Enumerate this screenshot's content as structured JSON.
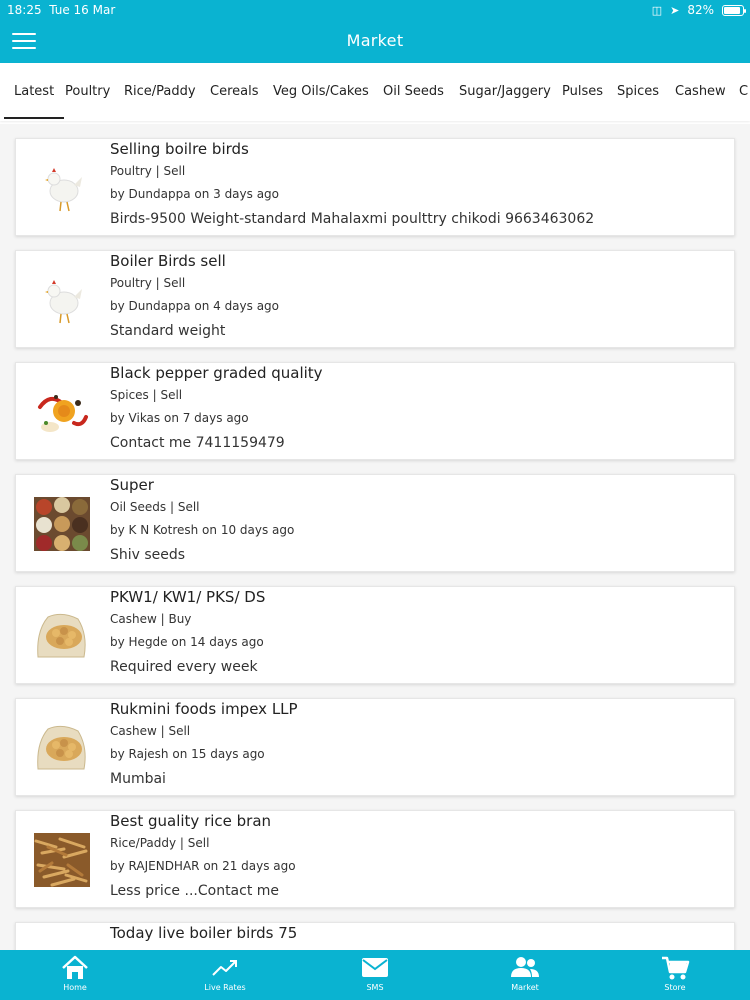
{
  "status_bar": {
    "time": "18:25",
    "date": "Tue 16 Mar",
    "battery": "82%"
  },
  "nav": {
    "title": "Market"
  },
  "tabs": [
    {
      "label": "Latest"
    },
    {
      "label": "Poultry"
    },
    {
      "label": "Rice/Paddy"
    },
    {
      "label": "Cereals"
    },
    {
      "label": "Veg Oils/Cakes"
    },
    {
      "label": "Oil Seeds"
    },
    {
      "label": "Sugar/Jaggery"
    },
    {
      "label": "Pulses"
    },
    {
      "label": "Spices"
    },
    {
      "label": "Cashew"
    },
    {
      "label": "C"
    }
  ],
  "listings": [
    {
      "title": "Selling boilre birds",
      "category": "Poultry | Sell",
      "byline": "by Dundappa on 3 days ago",
      "description": "Birds-9500 Weight-standard Mahalaxmi poulttry chikodi 9663463062",
      "image": "chicken-image"
    },
    {
      "title": "Boiler Birds sell",
      "category": "Poultry | Sell",
      "byline": "by Dundappa on 4 days ago",
      "description": "Standard weight",
      "image": "chicken-image"
    },
    {
      "title": "Black pepper graded quality",
      "category": "Spices | Sell",
      "byline": "by Vikas on 7 days ago",
      "description": "Contact me 7411159479",
      "image": "spices-image"
    },
    {
      "title": "Super",
      "category": "Oil Seeds | Sell",
      "byline": "by K N Kotresh on 10 days ago",
      "description": "Shiv seeds",
      "image": "seeds-image"
    },
    {
      "title": "PKW1/ KW1/ PKS/ DS",
      "category": "Cashew | Buy",
      "byline": "by Hegde on 14 days ago",
      "description": "Required every week",
      "image": "cashew-sack-image"
    },
    {
      "title": "Rukmini foods impex LLP",
      "category": "Cashew | Sell",
      "byline": "by Rajesh on 15 days ago",
      "description": "Mumbai",
      "image": "cashew-sack-image"
    },
    {
      "title": "Best guality rice bran",
      "category": "Rice/Paddy | Sell",
      "byline": "by RAJENDHAR on 21 days ago",
      "description": "Less price ...Contact me",
      "image": "rice-bran-image"
    },
    {
      "title": "Today live boiler birds 75",
      "category": "",
      "byline": "",
      "description": "",
      "image": ""
    }
  ],
  "bottom_nav": [
    {
      "label": "Home",
      "icon": "home-icon"
    },
    {
      "label": "Live Rates",
      "icon": "trend-chart-icon"
    },
    {
      "label": "SMS",
      "icon": "envelope-icon"
    },
    {
      "label": "Market",
      "icon": "people-icon"
    },
    {
      "label": "Store",
      "icon": "cart-icon"
    }
  ],
  "colors": {
    "primary": "#0ab3d1",
    "card_bg": "#ffffff",
    "list_bg": "#f5f5f5"
  }
}
